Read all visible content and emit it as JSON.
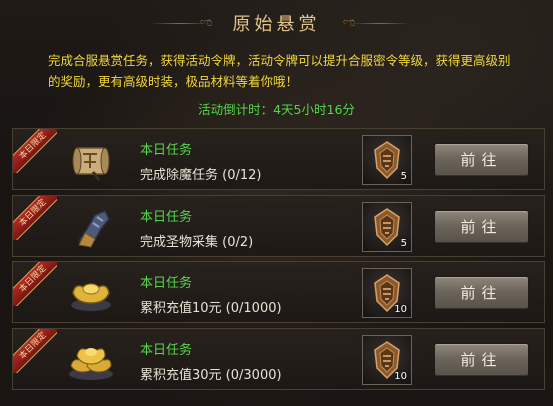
{
  "header": {
    "title": "原始悬赏"
  },
  "description": "完成合服悬赏任务，获得活动令牌，活动令牌可以提升合服密令等级，获得更高级别的奖励，更有高级时装，极品材料等着你哦！",
  "countdown": "活动倒计时：4天5小时16分",
  "tasks": [
    {
      "ribbon": "本日限定",
      "item_icon": "scroll-icon",
      "title": "本日任务",
      "desc": "完成除魔任务  (0/12)",
      "reward_count": "5",
      "button": "前往"
    },
    {
      "ribbon": "本日限定",
      "item_icon": "gauntlet-icon",
      "title": "本日任务",
      "desc": "完成圣物采集  (0/2)",
      "reward_count": "5",
      "button": "前往"
    },
    {
      "ribbon": "本日限定",
      "item_icon": "gold-ingot-icon",
      "title": "本日任务",
      "desc": "累积充值10元  (0/1000)",
      "reward_count": "10",
      "button": "前往"
    },
    {
      "ribbon": "本日限定",
      "item_icon": "gold-ingot-pile-icon",
      "title": "本日任务",
      "desc": "累积充值30元  (0/3000)",
      "reward_count": "10",
      "button": "前往"
    }
  ],
  "reward_icon": "token-medal-icon",
  "colors": {
    "title_gold": "#e3c48a",
    "desc_yellow": "#f2d83a",
    "countdown_green": "#55d64a",
    "task_green": "#58d64a",
    "ribbon_red": "#b02a22"
  }
}
